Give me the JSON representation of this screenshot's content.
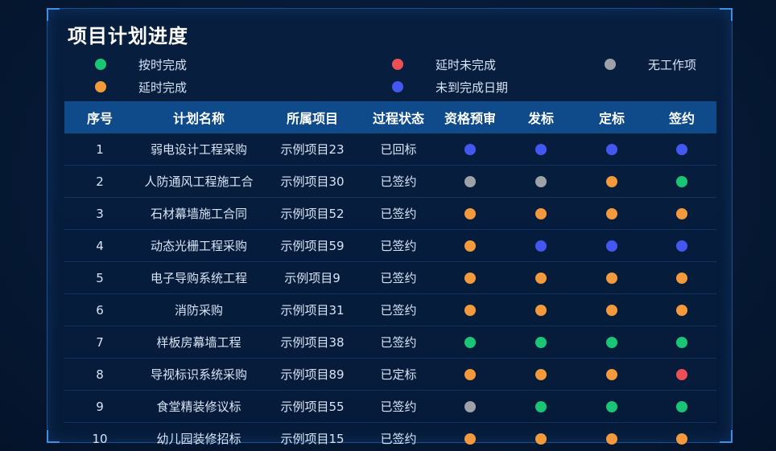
{
  "title": "项目计划进度",
  "colors": {
    "green": "#18c676",
    "orange": "#f49a3c",
    "red": "#ec4f55",
    "blue": "#4457f1",
    "gray": "#9ea2a8"
  },
  "legend": [
    {
      "label": "按时完成",
      "status": "green"
    },
    {
      "label": "延时未完成",
      "status": "red"
    },
    {
      "label": "无工作项",
      "status": "gray"
    },
    {
      "label": "延时完成",
      "status": "orange"
    },
    {
      "label": "未到完成日期",
      "status": "blue"
    }
  ],
  "table": {
    "headers": [
      "序号",
      "计划名称",
      "所属项目",
      "过程状态",
      "资格预审",
      "发标",
      "定标",
      "签约"
    ],
    "rows": [
      {
        "no": "1",
        "name": "弱电设计工程采购",
        "project": "示例项目23",
        "state": "已回标",
        "stages": [
          "blue",
          "blue",
          "blue",
          "blue"
        ]
      },
      {
        "no": "2",
        "name": "人防通风工程施工合",
        "project": "示例项目30",
        "state": "已签约",
        "stages": [
          "gray",
          "gray",
          "orange",
          "green"
        ]
      },
      {
        "no": "3",
        "name": "石材幕墙施工合同",
        "project": "示例项目52",
        "state": "已签约",
        "stages": [
          "orange",
          "orange",
          "orange",
          "orange"
        ]
      },
      {
        "no": "4",
        "name": "动态光栅工程采购",
        "project": "示例项目59",
        "state": "已签约",
        "stages": [
          "orange",
          "blue",
          "blue",
          "blue"
        ]
      },
      {
        "no": "5",
        "name": "电子导购系统工程",
        "project": "示例项目9",
        "state": "已签约",
        "stages": [
          "orange",
          "orange",
          "orange",
          "orange"
        ]
      },
      {
        "no": "6",
        "name": "消防采购",
        "project": "示例项目31",
        "state": "已签约",
        "stages": [
          "orange",
          "orange",
          "orange",
          "orange"
        ]
      },
      {
        "no": "7",
        "name": "样板房幕墙工程",
        "project": "示例项目38",
        "state": "已签约",
        "stages": [
          "green",
          "green",
          "green",
          "green"
        ]
      },
      {
        "no": "8",
        "name": "导视标识系统采购",
        "project": "示例项目89",
        "state": "已定标",
        "stages": [
          "orange",
          "orange",
          "orange",
          "red"
        ]
      },
      {
        "no": "9",
        "name": "食堂精装修议标",
        "project": "示例项目55",
        "state": "已签约",
        "stages": [
          "gray",
          "green",
          "green",
          "green"
        ]
      },
      {
        "no": "10",
        "name": "幼儿园装修招标",
        "project": "示例项目15",
        "state": "已签约",
        "stages": [
          "orange",
          "orange",
          "orange",
          "orange"
        ]
      }
    ]
  }
}
